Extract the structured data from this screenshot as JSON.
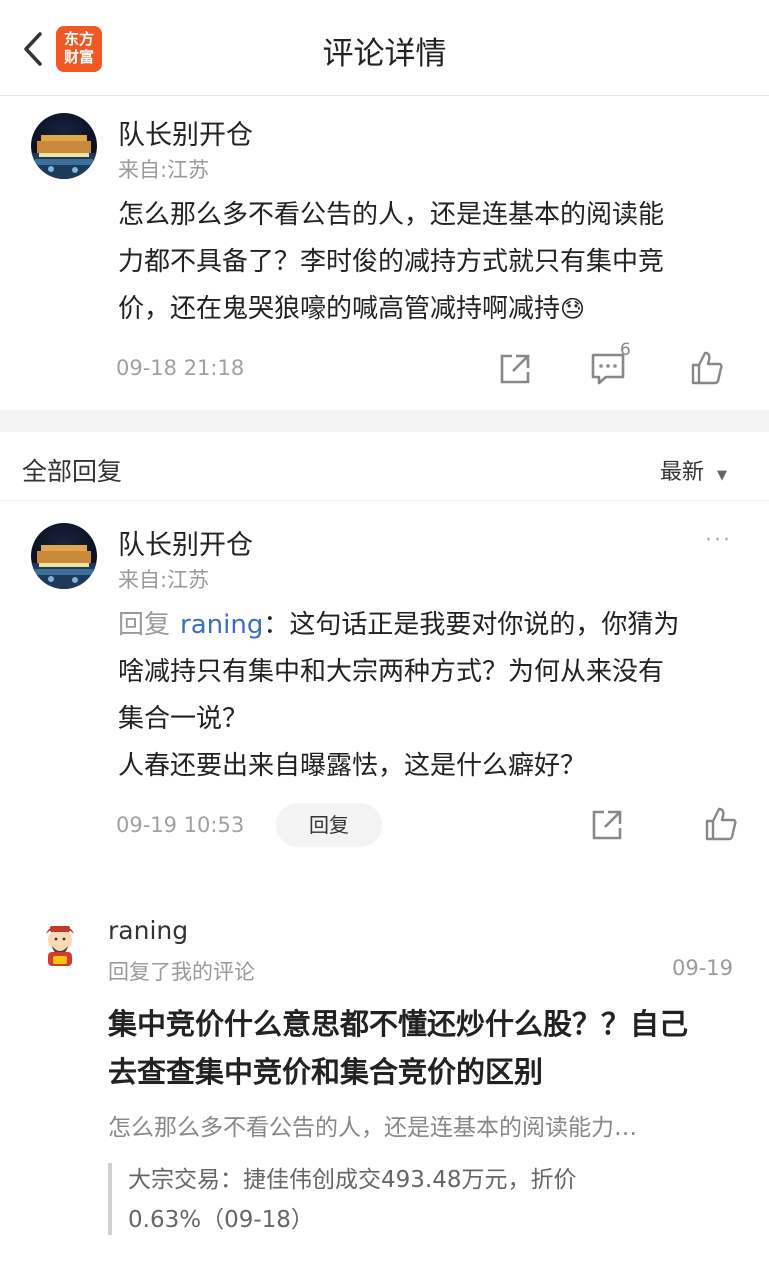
{
  "header": {
    "title": "评论详情",
    "logo_line1": "东方",
    "logo_line2": "财富"
  },
  "main_comment": {
    "user": "队长别开仓",
    "location": "来自:江苏",
    "text_lines": [
      "怎么那么多不看公告的人，还是连基本的阅读能",
      "力都不具备了？李时俊的减持方式就只有集中竞",
      "价，还在鬼哭狼嚎的喊高管减持啊减持"
    ],
    "emoji": "😓",
    "time": "09-18 21:18",
    "comment_count": "6"
  },
  "replies_section": {
    "title": "全部回复",
    "sort_label": "最新"
  },
  "reply": {
    "user": "队长别开仓",
    "location": "来自:江苏",
    "prefix": "回复",
    "mention": "raning",
    "colon": "：",
    "text_line1": "这句话正是我要对你说的，你猜为",
    "text_lines": [
      "啥减持只有集中和大宗两种方式？为何从来没有",
      "集合一说？",
      "人春还要出来自曝露怯，这是什么癖好？"
    ],
    "time": "09-19 10:53",
    "reply_button": "回复",
    "more": "···"
  },
  "notification": {
    "user": "raning",
    "action": "回复了我的评论",
    "date": "09-19",
    "headline_lines": [
      "集中竞价什么意思都不懂还炒什么股？？自己",
      "去查查集中竞价和集合竞价的区别"
    ],
    "quoted_comment": "怎么那么多不看公告的人，还是连基本的阅读能力…",
    "source_lines": [
      "大宗交易：捷佳伟创成交493.48万元，折价",
      "0.63%（09-18）"
    ]
  },
  "colors": {
    "accent": "#f05a22",
    "mention": "#3a6fc4",
    "muted": "#9a9a9a"
  }
}
